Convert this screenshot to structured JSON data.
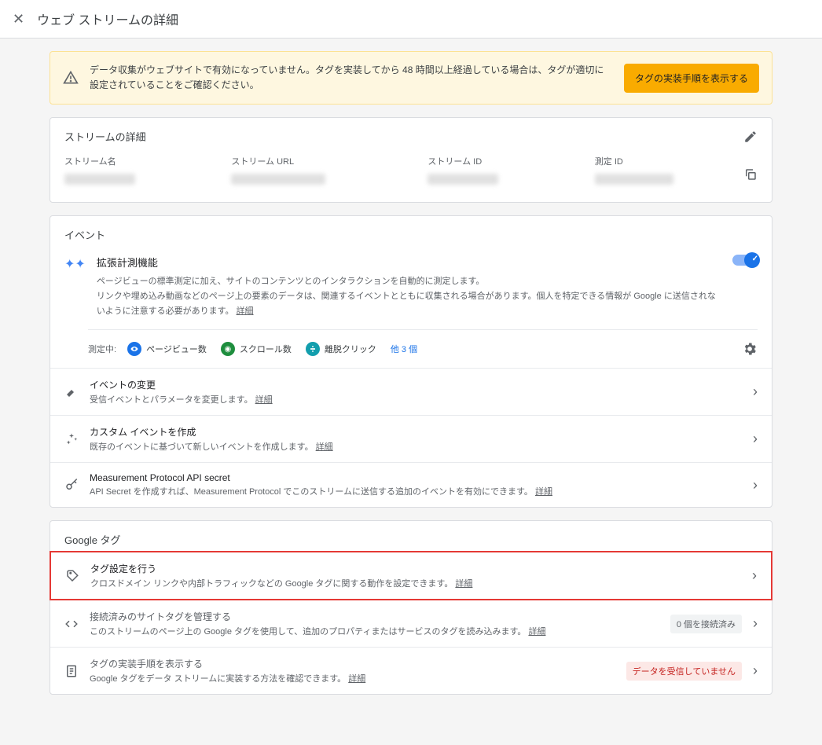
{
  "topbar": {
    "title": "ウェブ ストリームの詳細"
  },
  "alert": {
    "text": "データ収集がウェブサイトで有効になっていません。タグを実装してから 48 時間以上経過している場合は、タグが適切に設定されていることをご確認ください。",
    "button": "タグの実装手順を表示する"
  },
  "stream_card": {
    "header": "ストリームの詳細",
    "cols": {
      "name": "ストリーム名",
      "url": "ストリーム URL",
      "id": "ストリーム ID",
      "measurement": "測定 ID"
    }
  },
  "events": {
    "title": "イベント",
    "enhanced": {
      "title": "拡張計測機能",
      "desc1": "ページビューの標準測定に加え、サイトのコンテンツとのインタラクションを自動的に測定します。",
      "desc2": "リンクや埋め込み動画などのページ上の要素のデータは、関連するイベントとともに収集される場合があります。個人を特定できる情報が Google に送信されないように注意する必要があります。",
      "link": "詳細"
    },
    "measuring_label": "測定中:",
    "chips": {
      "pageview": "ページビュー数",
      "scroll": "スクロール数",
      "outbound": "離脱クリック"
    },
    "more": "他 3 個",
    "rows": [
      {
        "title": "イベントの変更",
        "desc": "受信イベントとパラメータを変更します。",
        "link": "詳細"
      },
      {
        "title": "カスタム イベントを作成",
        "desc": "既存のイベントに基づいて新しいイベントを作成します。",
        "link": "詳細"
      },
      {
        "title": "Measurement Protocol API secret",
        "desc": "API Secret を作成すれば、Measurement Protocol でこのストリームに送信する追加のイベントを有効にできます。",
        "link": "詳細"
      }
    ]
  },
  "gtag": {
    "title": "Google タグ",
    "rows": [
      {
        "title": "タグ設定を行う",
        "desc": "クロスドメイン リンクや内部トラフィックなどの Google タグに関する動作を設定できます。",
        "link": "詳細"
      },
      {
        "title": "接続済みのサイトタグを管理する",
        "desc": "このストリームのページ上の Google タグを使用して、追加のプロパティまたはサービスのタグを読み込みます。",
        "link": "詳細",
        "badge": "0 個を接続済み"
      },
      {
        "title": "タグの実装手順を表示する",
        "desc": "Google タグをデータ ストリームに実装する方法を確認できます。",
        "link": "詳細",
        "warn": "データを受信していません"
      }
    ]
  }
}
